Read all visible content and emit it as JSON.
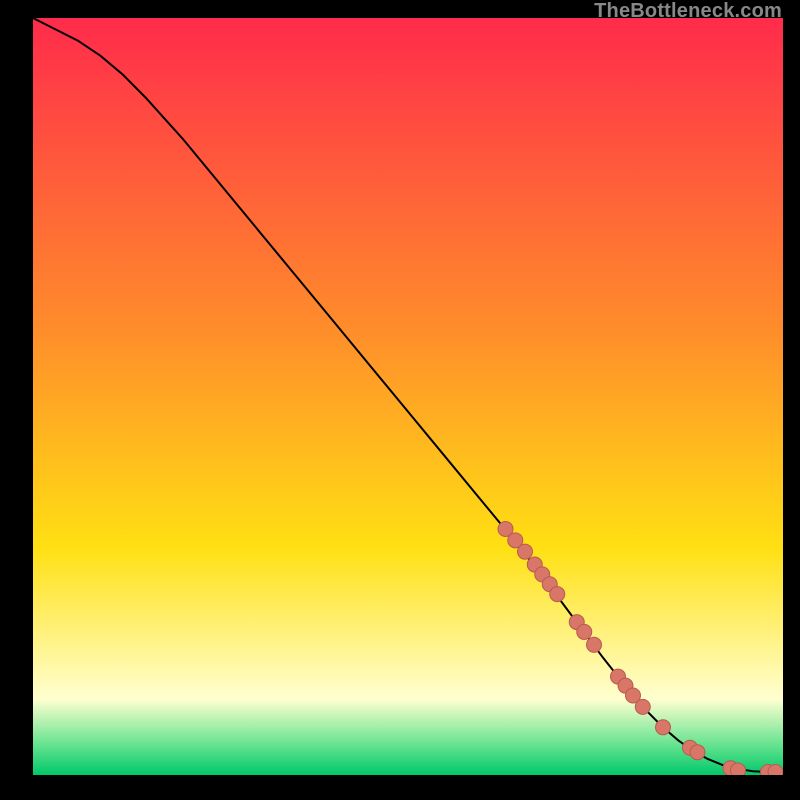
{
  "watermark": "TheBottleneck.com",
  "colors": {
    "grad_top": "#ff2b4b",
    "grad_mid1": "#ff8f2a",
    "grad_mid2": "#ffe013",
    "grad_mid3": "#ffffd0",
    "grad_mid4": "#66e390",
    "grad_bot": "#00c86a",
    "curve": "#000000",
    "marker_fill": "#d87668",
    "marker_stroke": "#b85a50"
  },
  "chart_data": {
    "type": "line",
    "title": "",
    "xlabel": "",
    "ylabel": "",
    "xlim": [
      0,
      100
    ],
    "ylim": [
      0,
      100
    ],
    "curve": {
      "x": [
        0,
        3,
        6,
        9,
        12,
        15,
        20,
        25,
        30,
        35,
        40,
        45,
        50,
        55,
        60,
        65,
        70,
        73,
        76,
        78,
        80,
        82,
        84,
        86,
        88,
        90,
        92,
        94,
        96,
        98,
        100
      ],
      "y": [
        100,
        98.5,
        97,
        95,
        92.5,
        89.5,
        84,
        78,
        72,
        66,
        60,
        54,
        48,
        42,
        36,
        30,
        23.5,
        19.5,
        15.5,
        13,
        10.5,
        8.3,
        6.3,
        4.6,
        3.2,
        2.1,
        1.3,
        0.8,
        0.5,
        0.4,
        0.4
      ]
    },
    "markers": {
      "x": [
        63,
        64.3,
        65.6,
        66.9,
        67.9,
        68.9,
        69.9,
        72.5,
        73.5,
        74.8,
        78.0,
        79.0,
        80.0,
        81.3,
        84.0,
        87.6,
        88.6,
        93.0,
        94.0,
        98.0,
        99.0
      ],
      "y": [
        32.5,
        31.0,
        29.5,
        27.8,
        26.5,
        25.2,
        23.9,
        20.2,
        18.9,
        17.2,
        13.0,
        11.8,
        10.5,
        9.0,
        6.3,
        3.6,
        3.0,
        0.9,
        0.6,
        0.4,
        0.4
      ]
    }
  }
}
